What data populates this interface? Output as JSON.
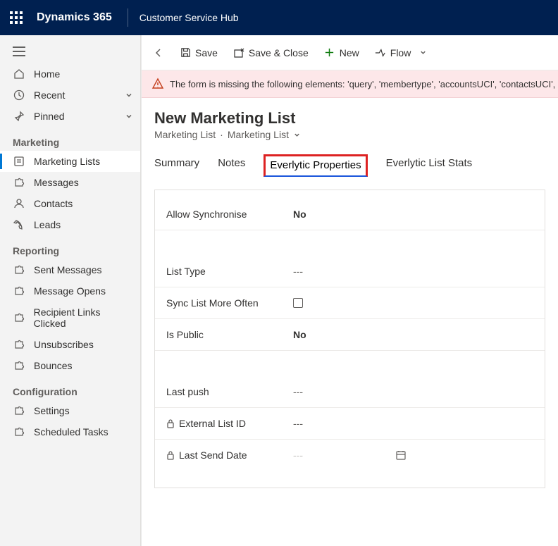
{
  "topbar": {
    "brand": "Dynamics 365",
    "hub": "Customer Service Hub"
  },
  "sidebar": {
    "top": [
      {
        "label": "Home",
        "icon": "home"
      },
      {
        "label": "Recent",
        "icon": "clock",
        "chevron": true
      },
      {
        "label": "Pinned",
        "icon": "pin",
        "chevron": true
      }
    ],
    "groups": [
      {
        "title": "Marketing",
        "items": [
          {
            "label": "Marketing Lists",
            "icon": "list",
            "active": true
          },
          {
            "label": "Messages",
            "icon": "puzzle"
          },
          {
            "label": "Contacts",
            "icon": "person"
          },
          {
            "label": "Leads",
            "icon": "phone"
          }
        ]
      },
      {
        "title": "Reporting",
        "items": [
          {
            "label": "Sent Messages",
            "icon": "puzzle"
          },
          {
            "label": "Message Opens",
            "icon": "puzzle"
          },
          {
            "label": "Recipient Links Clicked",
            "icon": "puzzle"
          },
          {
            "label": "Unsubscribes",
            "icon": "puzzle"
          },
          {
            "label": "Bounces",
            "icon": "puzzle"
          }
        ]
      },
      {
        "title": "Configuration",
        "items": [
          {
            "label": "Settings",
            "icon": "puzzle"
          },
          {
            "label": "Scheduled Tasks",
            "icon": "puzzle"
          }
        ]
      }
    ]
  },
  "commandbar": {
    "save": "Save",
    "save_close": "Save & Close",
    "new": "New",
    "flow": "Flow"
  },
  "warning": "The form is missing the following elements: 'query', 'membertype', 'accountsUCI', 'contactsUCI', 'leadsUCI'",
  "header": {
    "title": "New Marketing List",
    "crumb1": "Marketing List",
    "crumb2": "Marketing List"
  },
  "tabs": [
    "Summary",
    "Notes",
    "Everlytic Properties",
    "Everlytic List Stats"
  ],
  "active_tab": 2,
  "fields": {
    "allow_sync": {
      "label": "Allow Synchronise",
      "value": "No"
    },
    "list_type": {
      "label": "List Type",
      "value": "---"
    },
    "sync_more": {
      "label": "Sync List More Often"
    },
    "is_public": {
      "label": "Is Public",
      "value": "No"
    },
    "last_push": {
      "label": "Last push",
      "value": "---"
    },
    "ext_id": {
      "label": "External List ID",
      "value": "---",
      "locked": true
    },
    "last_send": {
      "label": "Last Send Date",
      "value": "---",
      "locked": true,
      "date": true
    }
  }
}
